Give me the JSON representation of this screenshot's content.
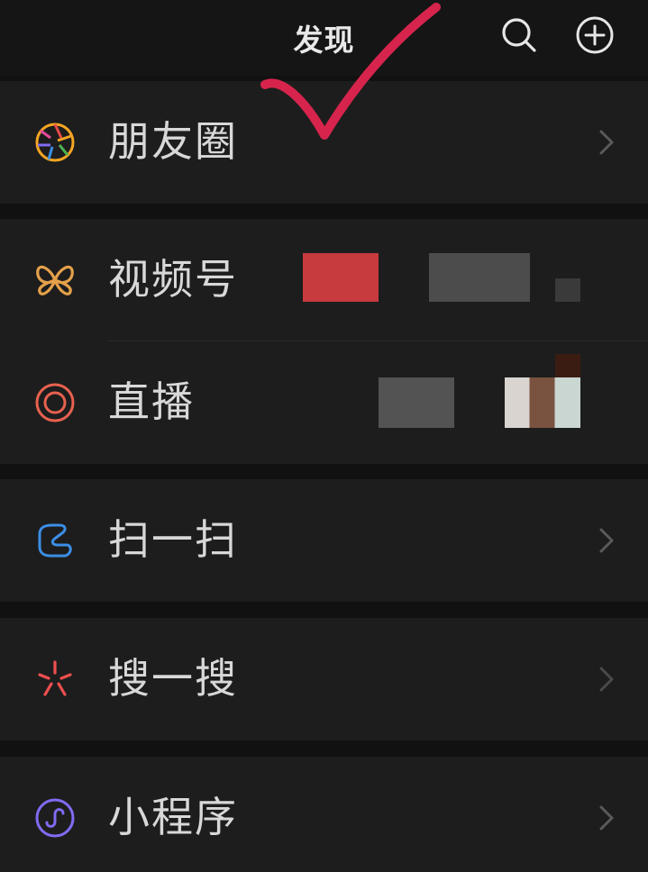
{
  "header": {
    "title": "发现",
    "icons": [
      "search-icon",
      "add-circle-icon"
    ]
  },
  "menu": [
    {
      "label": "朋友圈",
      "icon": "moments-aperture-icon",
      "icon_color": "#f5a623",
      "has_arrow": true
    },
    {
      "label": "视频号",
      "icon": "channels-butterfly-icon",
      "icon_color": "#e4a14a",
      "has_arrow": false
    },
    {
      "label": "直播",
      "icon": "live-ring-icon",
      "icon_color": "#e8614f",
      "has_arrow": false
    },
    {
      "label": "扫一扫",
      "icon": "scan-icon",
      "icon_color": "#3b8fe6",
      "has_arrow": true
    },
    {
      "label": "搜一搜",
      "icon": "search-sparkle-icon",
      "icon_color": "#ef4f4f",
      "has_arrow": true
    },
    {
      "label": "小程序",
      "icon": "mini-program-icon",
      "icon_color": "#7f6cf2",
      "has_arrow": true
    }
  ],
  "colors": {
    "background": "#111111",
    "row": "#1d1d1d",
    "text": "#d8d8d8",
    "checkmark": "#d6244d"
  }
}
